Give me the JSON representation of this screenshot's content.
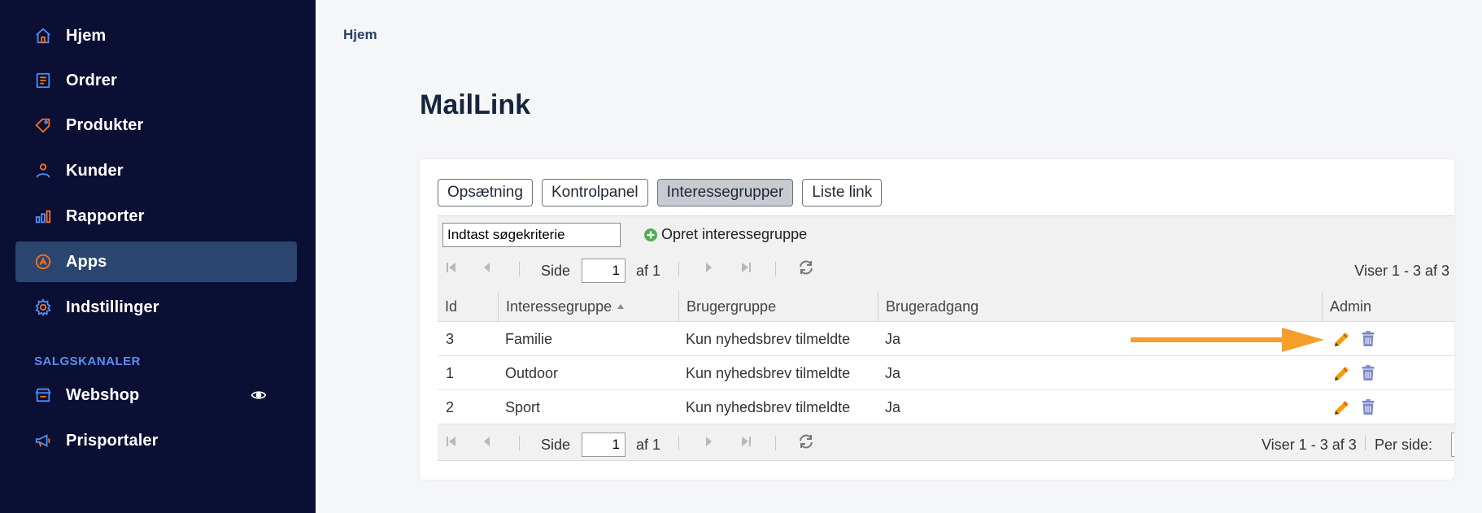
{
  "sidebar": {
    "items": [
      {
        "label": "Hjem",
        "icon": "home-icon"
      },
      {
        "label": "Ordrer",
        "icon": "orders-icon"
      },
      {
        "label": "Produkter",
        "icon": "tag-icon"
      },
      {
        "label": "Kunder",
        "icon": "user-icon"
      },
      {
        "label": "Rapporter",
        "icon": "bar-chart-icon"
      },
      {
        "label": "Apps",
        "icon": "apps-icon",
        "active": true
      },
      {
        "label": "Indstillinger",
        "icon": "gear-icon"
      }
    ],
    "section_label": "SALGSKANALER",
    "channels": [
      {
        "label": "Webshop",
        "icon": "store-icon"
      },
      {
        "label": "Prisportaler",
        "icon": "megaphone-icon"
      }
    ]
  },
  "breadcrumb": "Hjem",
  "page_title": "MailLink",
  "tabs": [
    {
      "label": "Opsætning"
    },
    {
      "label": "Kontrolpanel"
    },
    {
      "label": "Interessegrupper",
      "active": true
    },
    {
      "label": "Liste link"
    }
  ],
  "search": {
    "value": "Indtast søgekriterie"
  },
  "create_link": "Opret interessegruppe",
  "pager": {
    "side_label": "Side",
    "page_value": "1",
    "of_label": "af 1",
    "info": "Viser 1 - 3 af 3",
    "per_page_label": "Per side:"
  },
  "table": {
    "columns": [
      "Id",
      "Interessegruppe",
      "Brugergruppe",
      "Brugeradgang",
      "Admin"
    ],
    "rows": [
      {
        "id": "3",
        "group": "Familie",
        "usergroup": "Kun nyhedsbrev tilmeldte",
        "access": "Ja"
      },
      {
        "id": "1",
        "group": "Outdoor",
        "usergroup": "Kun nyhedsbrev tilmeldte",
        "access": "Ja"
      },
      {
        "id": "2",
        "group": "Sport",
        "usergroup": "Kun nyhedsbrev tilmeldte",
        "access": "Ja"
      }
    ]
  },
  "colors": {
    "sidebar_bg": "#0b0f33",
    "active_item": "#2a4670",
    "icon_accent": "#f97316",
    "icon_blue": "#4f8ef7",
    "arrow": "#f59e2a",
    "pencil": "#f59e0b",
    "trash": "#7b88c9"
  }
}
